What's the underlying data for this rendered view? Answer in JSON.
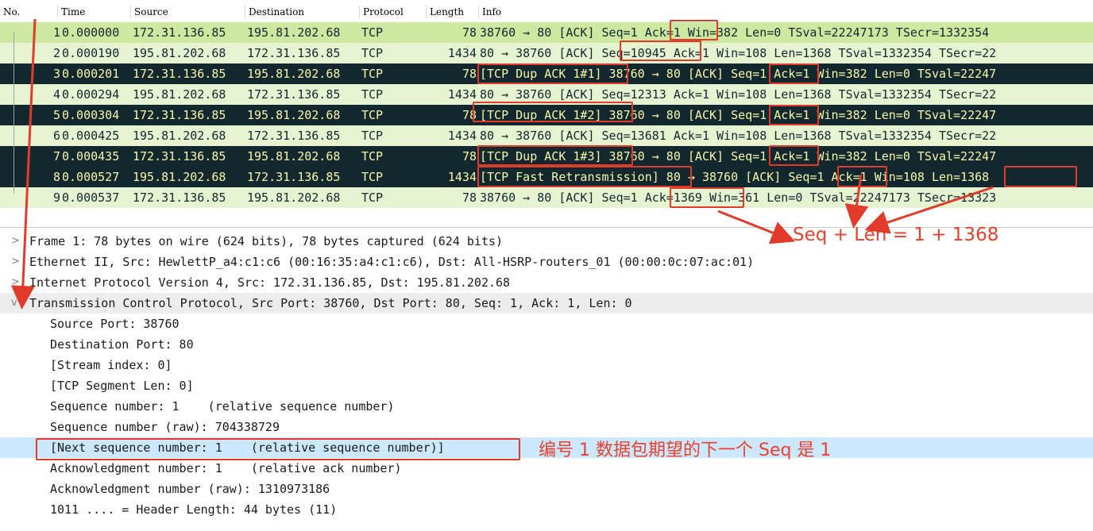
{
  "columns": [
    "No.",
    "Time",
    "Source",
    "Destination",
    "Protocol",
    "Length",
    "Info"
  ],
  "packets": [
    {
      "no": "1",
      "time": "0.000000",
      "src": "172.31.136.85",
      "dst": "195.81.202.68",
      "proto": "TCP",
      "len": "78",
      "info": "38760 → 80 [ACK] Seq=1 Ack=1 Win=382 Len=0 TSval=22247173 TSecr=1332354",
      "style": "sel"
    },
    {
      "no": "2",
      "time": "0.000190",
      "src": "195.81.202.68",
      "dst": "172.31.136.85",
      "proto": "TCP",
      "len": "1434",
      "info": "80 → 38760 [ACK] Seq=10945 Ack=1 Win=108 Len=1368 TSval=1332354 TSecr=22",
      "style": "light"
    },
    {
      "no": "3",
      "time": "0.000201",
      "src": "172.31.136.85",
      "dst": "195.81.202.68",
      "proto": "TCP",
      "len": "78",
      "info": "[TCP Dup ACK 1#1] 38760 → 80 [ACK] Seq=1 Ack=1 Win=382 Len=0 TSval=22247",
      "style": "dark"
    },
    {
      "no": "4",
      "time": "0.000294",
      "src": "195.81.202.68",
      "dst": "172.31.136.85",
      "proto": "TCP",
      "len": "1434",
      "info": "80 → 38760 [ACK] Seq=12313 Ack=1 Win=108 Len=1368 TSval=1332354 TSecr=22",
      "style": "light"
    },
    {
      "no": "5",
      "time": "0.000304",
      "src": "172.31.136.85",
      "dst": "195.81.202.68",
      "proto": "TCP",
      "len": "78",
      "info": "[TCP Dup ACK 1#2] 38760 → 80 [ACK] Seq=1 Ack=1 Win=382 Len=0 TSval=22247",
      "style": "dark"
    },
    {
      "no": "6",
      "time": "0.000425",
      "src": "195.81.202.68",
      "dst": "172.31.136.85",
      "proto": "TCP",
      "len": "1434",
      "info": "80 → 38760 [ACK] Seq=13681 Ack=1 Win=108 Len=1368 TSval=1332354 TSecr=22",
      "style": "light"
    },
    {
      "no": "7",
      "time": "0.000435",
      "src": "172.31.136.85",
      "dst": "195.81.202.68",
      "proto": "TCP",
      "len": "78",
      "info": "[TCP Dup ACK 1#3] 38760 → 80 [ACK] Seq=1 Ack=1 Win=382 Len=0 TSval=22247",
      "style": "dark"
    },
    {
      "no": "8",
      "time": "0.000527",
      "src": "195.81.202.68",
      "dst": "172.31.136.85",
      "proto": "TCP",
      "len": "1434",
      "info": "[TCP Fast Retransmission] 80 → 38760 [ACK] Seq=1 Ack=1 Win=108 Len=1368",
      "style": "dark"
    },
    {
      "no": "9",
      "time": "0.000537",
      "src": "172.31.136.85",
      "dst": "195.81.202.68",
      "proto": "TCP",
      "len": "78",
      "info": "38760 → 80 [ACK] Seq=1 Ack=1369 Win=361 Len=0 TSval=22247173 TSecr=13323",
      "style": "light"
    }
  ],
  "details": [
    {
      "text": "Frame 1: 78 bytes on wire (624 bits), 78 bytes captured (624 bits)",
      "expander": ">",
      "indent": 0
    },
    {
      "text": "Ethernet II, Src: HewlettP_a4:c1:c6 (00:16:35:a4:c1:c6), Dst: All-HSRP-routers_01 (00:00:0c:07:ac:01)",
      "expander": ">",
      "indent": 0
    },
    {
      "text": "Internet Protocol Version 4, Src: 172.31.136.85, Dst: 195.81.202.68",
      "expander": ">",
      "indent": 0
    },
    {
      "text": "Transmission Control Protocol, Src Port: 38760, Dst Port: 80, Seq: 1, Ack: 1, Len: 0",
      "expander": "v",
      "indent": 0
    },
    {
      "text": "Source Port: 38760",
      "expander": "",
      "indent": 1
    },
    {
      "text": "Destination Port: 80",
      "expander": "",
      "indent": 1
    },
    {
      "text": "[Stream index: 0]",
      "expander": "",
      "indent": 1
    },
    {
      "text": "[TCP Segment Len: 0]",
      "expander": "",
      "indent": 1
    },
    {
      "text": "Sequence number: 1    (relative sequence number)",
      "expander": "",
      "indent": 1
    },
    {
      "text": "Sequence number (raw): 704338729",
      "expander": "",
      "indent": 1
    },
    {
      "text": "[Next sequence number: 1    (relative sequence number)]",
      "expander": "",
      "indent": 1
    },
    {
      "text": "Acknowledgment number: 1    (relative ack number)",
      "expander": "",
      "indent": 1
    },
    {
      "text": "Acknowledgment number (raw): 1310973186",
      "expander": "",
      "indent": 1
    },
    {
      "text": "1011 .... = Header Length: 44 bytes (11)",
      "expander": "",
      "indent": 1
    }
  ],
  "annotations": {
    "formula": "Seq + Len = 1 + 1368",
    "next_seq_note": "编号 1 数据包期望的下一个 Seq 是 1"
  },
  "colors": {
    "annotation": "#e03b2b",
    "light_row": "#e7f4d2",
    "dark_row": "#12272e",
    "dark_text": "#f7f7a8",
    "highlight": "#cce8ff"
  }
}
